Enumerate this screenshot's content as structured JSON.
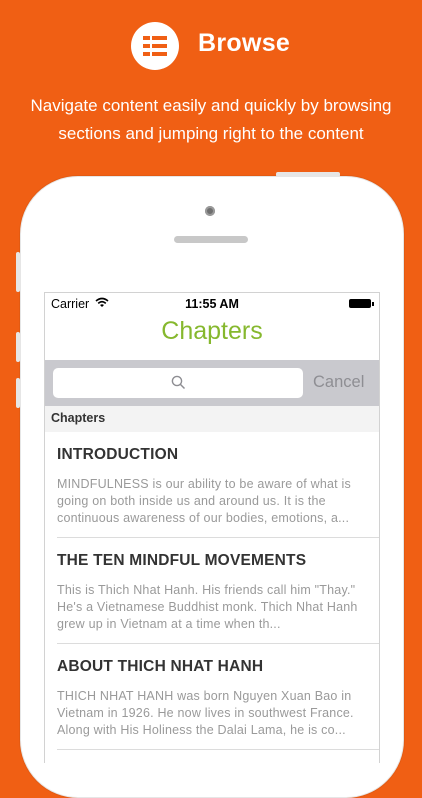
{
  "promo": {
    "title": "Browse",
    "subtitle": "Navigate content easily and quickly by browsing sections and jumping right to the content",
    "icon": "list-icon"
  },
  "colors": {
    "background": "#f05f14",
    "title_accent": "#86b82e",
    "cancel": "#8e8e93"
  },
  "status_bar": {
    "carrier": "Carrier",
    "time": "11:55 AM"
  },
  "navbar": {
    "title": "Chapters"
  },
  "search": {
    "placeholder": "",
    "cancel_label": "Cancel"
  },
  "section_header": "Chapters",
  "chapters": [
    {
      "title": "INTRODUCTION",
      "excerpt": "MINDFULNESS is our ability to be aware of what is going on both inside us and around us. It is the continuous awareness of our bodies, emotions, a..."
    },
    {
      "title": "THE TEN MINDFUL MOVEMENTS",
      "excerpt": "This is Thich Nhat Hanh. His friends call him \"Thay.\" He's a Vietnamese Buddhist monk. Thich Nhat Hanh grew up in Vietnam at a time when th..."
    },
    {
      "title": "ABOUT THICH NHAT HANH",
      "excerpt": "THICH NHAT HANH was born Nguyen Xuan Bao in Vietnam in 1926. He now lives in southwest France. Along with His Holiness the Dalai Lama, he is co..."
    }
  ]
}
